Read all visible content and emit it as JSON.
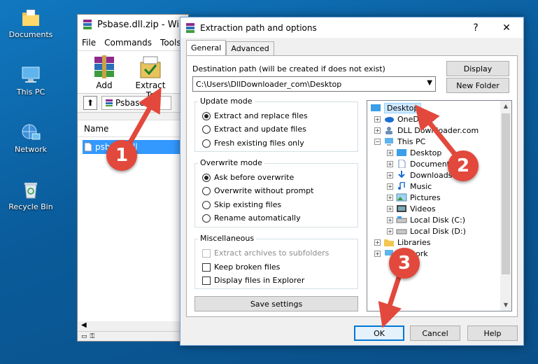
{
  "desktop": {
    "icons": [
      {
        "label": "Documents",
        "icon": "folder-icon"
      },
      {
        "label": "This PC",
        "icon": "computer-icon"
      },
      {
        "label": "Network",
        "icon": "network-icon"
      },
      {
        "label": "Recycle Bin",
        "icon": "recycle-bin-icon"
      }
    ]
  },
  "winrar": {
    "title": "Psbase.dll.zip - Win",
    "menu": [
      "File",
      "Commands",
      "Tools"
    ],
    "toolbar": {
      "add": "Add",
      "extract_to": "Extract To",
      "test": "T"
    },
    "path_text": "Psbase.dll.",
    "column_name": "Name",
    "file": "psbase.dll"
  },
  "dialog": {
    "title": "Extraction path and options",
    "help_glyph": "?",
    "close_glyph": "✕",
    "tabs": [
      "General",
      "Advanced"
    ],
    "dest_label": "Destination path (will be created if does not exist)",
    "dest_value": "C:\\Users\\DllDownloader_com\\Desktop",
    "display_button": "Display",
    "new_folder_button": "New Folder",
    "update_mode": {
      "title": "Update mode",
      "options": [
        "Extract and replace files",
        "Extract and update files",
        "Fresh existing files only"
      ],
      "selected": 0
    },
    "overwrite_mode": {
      "title": "Overwrite mode",
      "options": [
        "Ask before overwrite",
        "Overwrite without prompt",
        "Skip existing files",
        "Rename automatically"
      ],
      "selected": 0
    },
    "misc": {
      "title": "Miscellaneous",
      "options": [
        "Extract archives to subfolders",
        "Keep broken files",
        "Display files in Explorer"
      ]
    },
    "save_settings": "Save settings",
    "tree": [
      {
        "label": "Desktop",
        "selected": true
      },
      {
        "label": "OneDri"
      },
      {
        "label": "DLL Downloader.com"
      },
      {
        "label": "This PC"
      },
      {
        "label": "Desktop"
      },
      {
        "label": "Documents"
      },
      {
        "label": "Downloads"
      },
      {
        "label": "Music"
      },
      {
        "label": "Pictures"
      },
      {
        "label": "Videos"
      },
      {
        "label": "Local Disk (C:)"
      },
      {
        "label": "Local Disk (D:)"
      },
      {
        "label": "Libraries"
      },
      {
        "label": "ork"
      }
    ],
    "ok": "OK",
    "cancel": "Cancel",
    "help": "Help"
  },
  "annotations": [
    "1",
    "2",
    "3"
  ],
  "colors": {
    "accent": "#0078d7",
    "annotation": "#e2483c",
    "selection": "#3399ff"
  }
}
